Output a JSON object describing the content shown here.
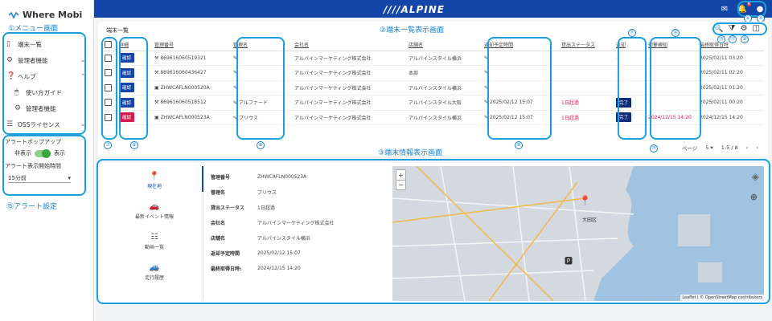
{
  "sidebar": {
    "logo": "Where Mobi",
    "menu_annotation": "①メニュー画面",
    "items": [
      {
        "label": "端末一覧",
        "icon": "smartphone-icon"
      },
      {
        "label": "管理者機能",
        "icon": "gear-icon"
      },
      {
        "label": "ヘルプ",
        "icon": "help-icon"
      },
      {
        "label": "使い方ガイド",
        "icon": "mouse-icon"
      },
      {
        "label": "管理者機能",
        "icon": "gear-icon"
      },
      {
        "label": "OSSライセンス",
        "icon": "list-icon"
      }
    ],
    "alert": {
      "popup_label": "アラートポップアップ",
      "hide_label": "非表示",
      "show_label": "表示",
      "start_label": "アラート表示開始時間",
      "start_value": "15分前",
      "annotation": "⑮アラート設定"
    }
  },
  "topbar": {
    "brand": "////ALPINE",
    "badge": "6",
    "nums": {
      "n5": "⑤",
      "n4": "④",
      "n6": "⑥",
      "n7": "⑦"
    }
  },
  "list": {
    "title": "端末一覧",
    "annotation": "②端末一覧表示画面",
    "columns": [
      "詳細",
      "管理番号",
      "管理名",
      "会社名",
      "店舗名",
      "返却予定時間",
      "貸出ステータス",
      "返却",
      "衝撃検知",
      "最終取得日時"
    ],
    "button_label": "確認",
    "done_label": "完了",
    "rows": [
      {
        "id": "869616060519321",
        "name": "",
        "company": "アルパインマーケティング株式会社",
        "store": "アルパインスタイル横浜",
        "ret": "",
        "status": "",
        "done": "",
        "impact": "",
        "last": "2025/02/11 03:20",
        "btn": "blue"
      },
      {
        "id": "869616060436427",
        "name": "",
        "company": "アルパインマーケティング株式会社",
        "store": "本部",
        "ret": "",
        "status": "",
        "done": "",
        "impact": "",
        "last": "2025/02/11 02:20",
        "btn": "blue"
      },
      {
        "id": "ZHWCAFLN000520A",
        "name": "",
        "company": "アルパインマーケティング株式会社",
        "store": "アルパインスタイル横浜",
        "ret": "",
        "status": "",
        "done": "",
        "impact": "",
        "last": "2025/02/11 01:20",
        "btn": "blue"
      },
      {
        "id": "869616060518512",
        "name": "アルファード",
        "company": "アルパインマーケティング株式会社",
        "store": "アルパインスタイル大阪",
        "ret": "2025/02/12 15:07",
        "status": "1日超過",
        "done": "完了",
        "impact": "",
        "last": "2025/02/11 00:20",
        "btn": "blue"
      },
      {
        "id": "ZHWCAFLN000523A",
        "name": "プリウス",
        "company": "アルパインマーケティング株式会社",
        "store": "アルパインスタイル横浜",
        "ret": "2025/02/12 15:07",
        "status": "1日超過",
        "done": "完了",
        "impact": "2024/12/15 14:20",
        "last": "2024/12/15 14:20",
        "btn": "red"
      }
    ],
    "pagination": {
      "label": "ページ",
      "per_page": "5",
      "range": "1-5 / 8"
    },
    "nums": {
      "n7": "⑦",
      "n6": "⑥",
      "n8": "⑧",
      "n10": "⑩",
      "n11": "⑪",
      "n12": "⑫",
      "n13": "⑬",
      "n14": "⑭",
      "n15": "⑮",
      "n9": "⑨"
    }
  },
  "detail": {
    "annotation": "③端末情報表示画面",
    "tabs": [
      {
        "label": "現在地",
        "icon": "pin-icon"
      },
      {
        "label": "最新イベント情報",
        "icon": "car-icon"
      },
      {
        "label": "動画一覧",
        "icon": "video-list-icon"
      },
      {
        "label": "走行履歴",
        "icon": "route-icon"
      }
    ],
    "info": [
      {
        "k": "管理番号",
        "v": "ZHWCAFLN000523A"
      },
      {
        "k": "管理名",
        "v": "プリウス"
      },
      {
        "k": "貸出ステータス",
        "v": "1日超過"
      },
      {
        "k": "会社名",
        "v": "アルパインマーケティング株式会社"
      },
      {
        "k": "店舗名",
        "v": "アルパインスタイル横浜"
      },
      {
        "k": "返却予定時間",
        "v": "2025/02/12 15:07"
      },
      {
        "k": "最終取得日時:",
        "v": "2024/12/15 14:20"
      }
    ],
    "map": {
      "attribution": "Leaflet | © OpenStreetMap contributors",
      "city": "大田区"
    }
  },
  "colors": {
    "accent": "#1346a8",
    "annotation": "#1a7fd1",
    "alert": "#d81b4f"
  }
}
